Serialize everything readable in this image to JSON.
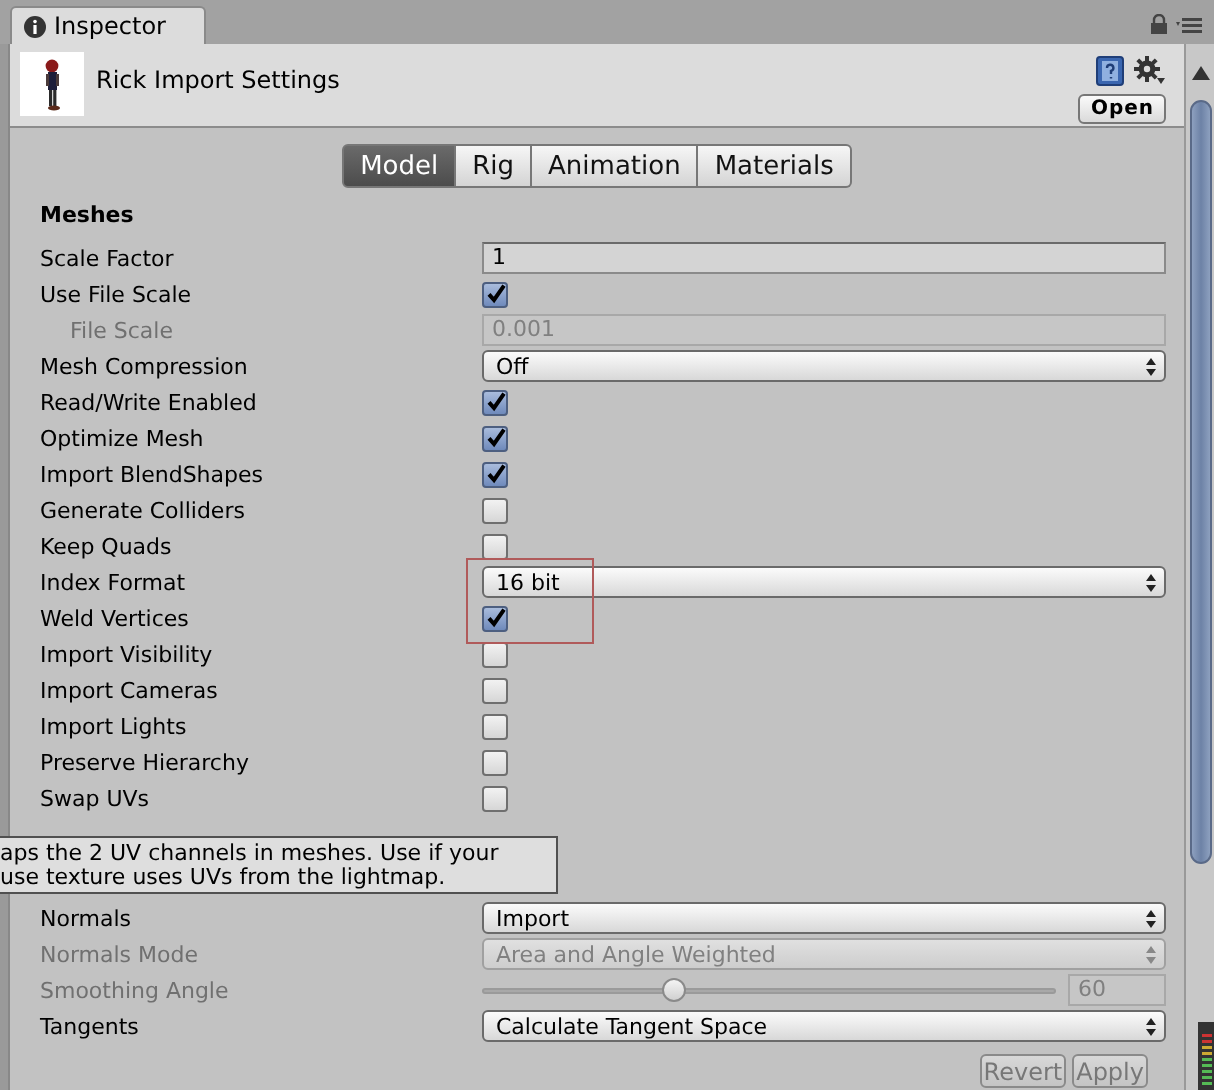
{
  "window": {
    "tab": "Inspector"
  },
  "header": {
    "title": "Rick Import Settings",
    "open_button": "Open"
  },
  "tabs": [
    {
      "label": "Model",
      "selected": true
    },
    {
      "label": "Rig",
      "selected": false
    },
    {
      "label": "Animation",
      "selected": false
    },
    {
      "label": "Materials",
      "selected": false
    }
  ],
  "section": "Meshes",
  "rows": [
    {
      "kind": "text",
      "label": "Scale Factor",
      "value": "1",
      "disabled": false
    },
    {
      "kind": "checkbox",
      "label": "Use File Scale",
      "checked": true,
      "disabled": false,
      "children": [
        {
          "kind": "text",
          "label": "File Scale",
          "value": "0.001",
          "disabled": true
        }
      ]
    },
    {
      "kind": "dropdown",
      "label": "Mesh Compression",
      "value": "Off",
      "disabled": false
    },
    {
      "kind": "checkbox",
      "label": "Read/Write Enabled",
      "checked": true,
      "disabled": false
    },
    {
      "kind": "checkbox",
      "label": "Optimize Mesh",
      "checked": true,
      "disabled": false
    },
    {
      "kind": "checkbox",
      "label": "Import BlendShapes",
      "checked": true,
      "disabled": false
    },
    {
      "kind": "checkbox",
      "label": "Generate Colliders",
      "checked": false,
      "disabled": false
    },
    {
      "kind": "checkbox",
      "label": "Keep Quads",
      "checked": false,
      "disabled": false
    },
    {
      "kind": "dropdown",
      "label": "Index Format",
      "value": "16 bit",
      "disabled": false
    },
    {
      "kind": "checkbox",
      "label": "Weld Vertices",
      "checked": true,
      "disabled": false
    },
    {
      "kind": "checkbox",
      "label": "Import Visibility",
      "checked": false,
      "disabled": false
    },
    {
      "kind": "checkbox",
      "label": "Import Cameras",
      "checked": false,
      "disabled": false
    },
    {
      "kind": "checkbox",
      "label": "Import Lights",
      "checked": false,
      "disabled": false
    },
    {
      "kind": "checkbox",
      "label": "Preserve Hierarchy",
      "checked": false,
      "disabled": false
    },
    {
      "kind": "checkbox",
      "label": "Swap UVs",
      "checked": false,
      "disabled": false
    }
  ],
  "normals_rows": [
    {
      "kind": "dropdown",
      "label": "Normals",
      "value": "Import",
      "disabled": false
    },
    {
      "kind": "dropdown",
      "label": "Normals Mode",
      "value": "Area and Angle Weighted",
      "disabled": true
    },
    {
      "kind": "slider",
      "label": "Smoothing Angle",
      "level": 0.333,
      "value": "60",
      "disabled": true
    },
    {
      "kind": "dropdown",
      "label": "Tangents",
      "value": "Calculate Tangent Space",
      "disabled": false
    }
  ],
  "tooltip": {
    "lines": [
      "aps the 2 UV channels in meshes. Use if your",
      "use texture uses UVs from the lightmap."
    ]
  },
  "highlight_box": true,
  "footer_buttons": [
    {
      "label": "Revert"
    },
    {
      "label": "Apply"
    }
  ]
}
